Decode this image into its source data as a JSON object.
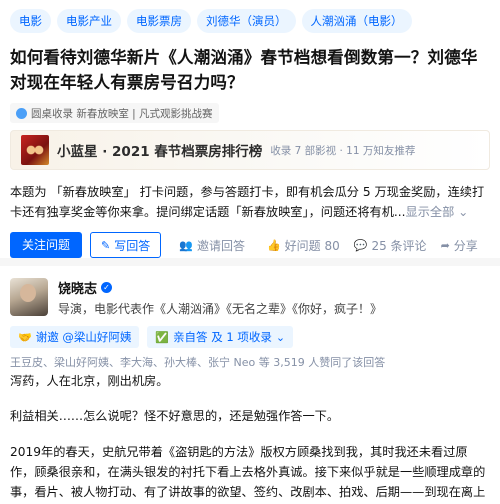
{
  "question": {
    "topics": [
      "电影",
      "电影产业",
      "电影票房",
      "刘德华（演员）",
      "人潮汹涌（电影）"
    ],
    "title": "如何看待刘德华新片《人潮汹涌》春节档想看倒数第一？刘德华对现在年轻人有票房号召力吗？",
    "collected": "圆桌收录 新春放映室 | 凡式观影挑战赛",
    "rank": {
      "title": "小蓝星 · 2021 春节档票房排行榜",
      "meta": "收录 7 部影视 · 11 万知友推荐"
    },
    "description": "本题为 「新春放映室」 打卡问题，参与答题打卡，即有机会瓜分 5 万现金奖励，连续打卡还有独享奖金等你来拿。提问绑定话题「新春放映室」，问题还将有机...",
    "show_all": "显示全部",
    "actions": {
      "follow": "关注问题",
      "write_answer": "写回答",
      "invite": "邀请回答",
      "likes": "好问题 80",
      "comments": "25 条评论",
      "share": "分享"
    }
  },
  "answer": {
    "author_name": "饶晓志",
    "author_bio": "导演，电影代表作《人潮汹涌》《无名之辈》《你好，疯子！》",
    "thanks_tag": "谢邀 @梁山好阿姨",
    "self_agree_tag": "亲自答 及 1 项收录",
    "agree_line": "王豆皮、梁山好阿姨、李大海、孙大棒、张宁 Neo 等 3,519 人赞同了该回答",
    "paragraphs": [
      "泻药，人在北京，刚出机房。",
      "利益相关……怎么说呢？怪不好意思的，还是勉强作答一下。",
      "2019年的春天，史航兄带着《盗钥匙的方法》版权方顾桑找到我，其时我还未看过原作，顾桑很亲和，在满头银发的衬托下看上去格外真诚。接下来似乎就是一些顺理成章的事，看片、被人物打动、有了讲故事的欲望、签约、改剧本、拍戏、后期——到现在离上映已经不足十天。"
    ]
  },
  "colors": {
    "accent": "#0066ff",
    "muted": "#8590a6",
    "tag_bg": "#ebf5ff"
  }
}
